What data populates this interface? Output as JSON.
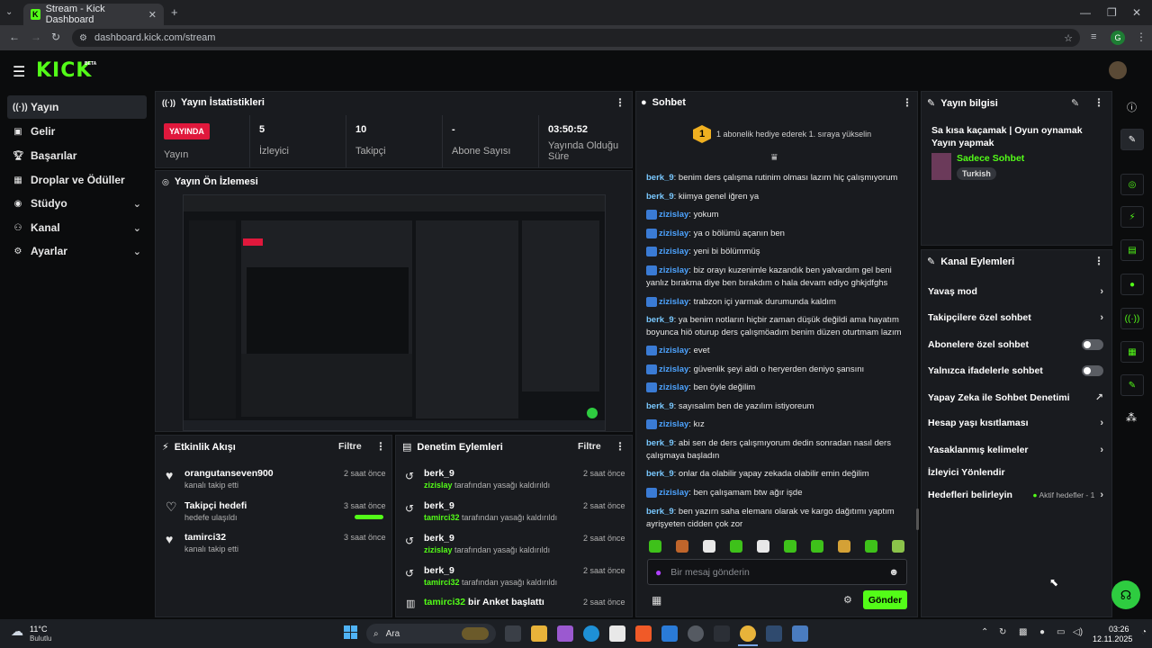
{
  "browser": {
    "tab_title": "Stream - Kick Dashboard",
    "url": "dashboard.kick.com/stream",
    "profile_initial": "G"
  },
  "brand": {
    "logo": "KICK",
    "beta": "BETA",
    "accent": "#53fc18"
  },
  "sidebar": {
    "items": [
      {
        "label": "Yayın",
        "icon": "broadcast-icon"
      },
      {
        "label": "Gelir",
        "icon": "revenue-icon"
      },
      {
        "label": "Başarılar",
        "icon": "trophy-icon"
      },
      {
        "label": "Droplar ve Ödüller",
        "icon": "gift-icon"
      },
      {
        "label": "Stüdyo",
        "icon": "studio-icon"
      },
      {
        "label": "Kanal",
        "icon": "channel-icon"
      },
      {
        "label": "Ayarlar",
        "icon": "gear-icon"
      }
    ]
  },
  "stats": {
    "title": "Yayın İstatistikleri",
    "live_badge": "YAYINDA",
    "status_label": "Yayın",
    "viewers_value": "5",
    "viewers_label": "İzleyici",
    "followers_value": "10",
    "followers_label": "Takipçi",
    "subs_value": "-",
    "subs_label": "Abone Sayısı",
    "duration_value": "03:50:52",
    "duration_label": "Yayında Olduğu Süre"
  },
  "preview": {
    "title": "Yayın Ön İzlemesi"
  },
  "activity": {
    "title": "Etkinlik Akışı",
    "filter": "Filtre",
    "rows": [
      {
        "name": "orangutanseven900",
        "sub": "kanalı takip etti",
        "time": "2 saat önce"
      },
      {
        "name": "Takipçi hedefi",
        "sub": "hedefe ulaşıldı",
        "time": "3 saat önce"
      },
      {
        "name": "tamirci32",
        "sub": "kanalı takip etti",
        "time": "3 saat önce"
      }
    ]
  },
  "moderation": {
    "title": "Denetim Eylemleri",
    "filter": "Filtre",
    "rows": [
      {
        "name": "berk_9",
        "by": "zizislay",
        "sub": "tarafından yasağı kaldırıldı",
        "time": "2 saat önce"
      },
      {
        "name": "berk_9",
        "by": "tamirci32",
        "sub": "tarafından yasağı kaldırıldı",
        "time": "2 saat önce"
      },
      {
        "name": "berk_9",
        "by": "zizislay",
        "sub": "tarafından yasağı kaldırıldı",
        "time": "2 saat önce"
      },
      {
        "name": "berk_9",
        "by": "tamirci32",
        "sub": "tarafından yasağı kaldırıldı",
        "time": "2 saat önce"
      }
    ],
    "poll_user": "tamirci32",
    "poll_text": "bir Anket başlattı",
    "poll_time": "2 saat önce"
  },
  "chat": {
    "title": "Sohbet",
    "gift_rank": "1",
    "gift_banner": "1 abonelik hediye ederek 1. sıraya yükselin",
    "placeholder": "Bir mesaj gönderin",
    "send": "Gönder",
    "messages": [
      {
        "user": "berk_9",
        "text": "benim ders çalışma rutinim olması lazım hiç çalışmıyorum"
      },
      {
        "user": "berk_9",
        "text": "kiimya genel iğren ya"
      },
      {
        "user": "zizislay",
        "text": "yokum"
      },
      {
        "user": "zizislay",
        "text": "ya o bölümü açanın ben"
      },
      {
        "user": "zizislay",
        "text": "yeni bi bölümmüş"
      },
      {
        "user": "zizislay",
        "text": "biz orayı kuzenimle kazandık ben yalvardım gel beni yanlız bırakma diye ben bırakdım o hala devam ediyo ghkjdfghs"
      },
      {
        "user": "zizislay",
        "text": "trabzon içi yarmak durumunda kaldım"
      },
      {
        "user": "berk_9",
        "text": "ya benim notların hiçbir zaman düşük değildi ama hayatım boyunca hiö oturup ders çalışmöadım benim düzen oturtmam lazım"
      },
      {
        "user": "zizislay",
        "text": "evet"
      },
      {
        "user": "zizislay",
        "text": "güvenlik şeyi aldı o heryerden deniyo şansını"
      },
      {
        "user": "zizislay",
        "text": "ben öyle değilim"
      },
      {
        "user": "berk_9",
        "text": "sayısalım ben de yazılım istiyoreum"
      },
      {
        "user": "zizislay",
        "text": "kız"
      },
      {
        "user": "berk_9",
        "text": "abi sen de ders çalışmıyorum dedin sonradan nasıl ders çalışmaya başladın"
      },
      {
        "user": "berk_9",
        "text": "onlar da olabilir yapay zekada olabilir emin değilim"
      },
      {
        "user": "zizislay",
        "text": "ben çalışamam btw ağır işde"
      },
      {
        "user": "berk_9",
        "text": "ben yazırn saha elemanı olarak ve kargo dağıtımı yaptım ayrişyeten cidden çok zor"
      }
    ]
  },
  "stream_info": {
    "title": "Yayın bilgisi",
    "stream_title": "Sa kısa kaçamak | Oyun oynamak Yayın yapmak",
    "category": "Sadece Sohbet",
    "tag": "Turkish"
  },
  "channel_actions": {
    "title": "Kanal Eylemleri",
    "items": [
      {
        "label": "Yavaş mod",
        "kind": "chevron"
      },
      {
        "label": "Takipçilere özel sohbet",
        "kind": "chevron"
      },
      {
        "label": "Abonelere özel sohbet",
        "kind": "toggle"
      },
      {
        "label": "Yalnızca ifadelerle sohbet",
        "kind": "toggle"
      },
      {
        "label": "Yapay Zeka ile Sohbet Denetimi",
        "kind": "external"
      },
      {
        "label": "Hesap yaşı kısıtlaması",
        "kind": "chevron"
      },
      {
        "label": "Yasaklanmış kelimeler",
        "kind": "chevron"
      },
      {
        "label": "İzleyici Yönlendir",
        "kind": "none"
      },
      {
        "label": "Hedefleri belirleyin",
        "kind": "chevron"
      }
    ],
    "goals_status": "Aktif hedefler - 1"
  },
  "taskbar": {
    "weather_temp": "11°C",
    "weather_desc": "Bulutlu",
    "search": "Ara",
    "time": "03:26",
    "date": "12.11.2025"
  }
}
